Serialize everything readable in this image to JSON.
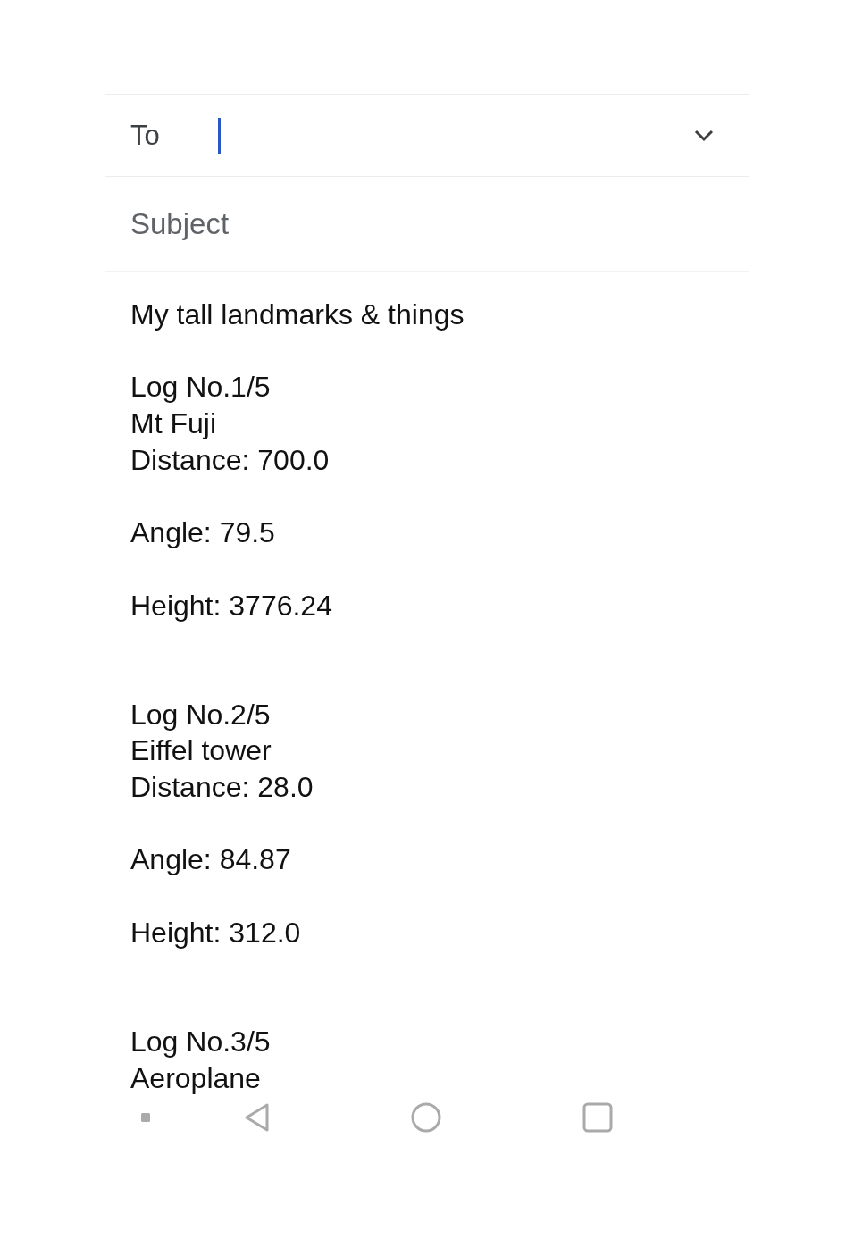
{
  "to": {
    "label": "To"
  },
  "subject": {
    "placeholder": "Subject"
  },
  "body": {
    "title": "My tall landmarks & things",
    "logs": [
      {
        "number": "Log No.1/5",
        "name": "Mt Fuji",
        "distance": "Distance: 700.0",
        "angle": "Angle: 79.5",
        "height": "Height: 3776.24"
      },
      {
        "number": "Log No.2/5",
        "name": "Eiffel tower",
        "distance": "Distance: 28.0",
        "angle": "Angle: 84.87",
        "height": "Height: 312.0"
      },
      {
        "number": "Log No.3/5",
        "name": "Aeroplane"
      }
    ]
  },
  "nav_bar": {
    "buttons": [
      {
        "kind": "dot"
      },
      {
        "kind": "back"
      },
      {
        "kind": "home"
      },
      {
        "kind": "recents"
      }
    ]
  }
}
